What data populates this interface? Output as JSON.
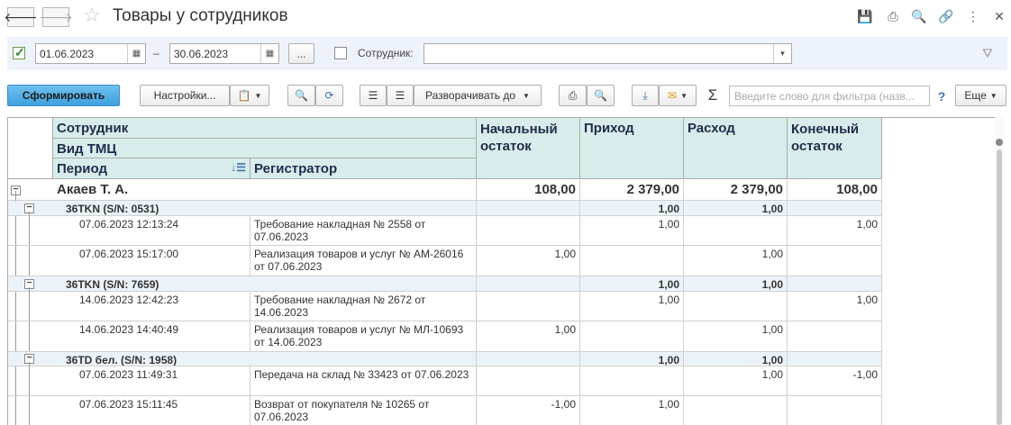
{
  "window": {
    "title": "Товары у сотрудников"
  },
  "filters": {
    "date_from": "01.06.2023",
    "date_to": "30.06.2023",
    "range_dash": "–",
    "more_button": "...",
    "employee_label": "Сотрудник:",
    "employee_value": ""
  },
  "toolbar": {
    "generate": "Сформировать",
    "settings": "Настройки...",
    "expand_to": "Разворачивать до",
    "sum_symbol": "Σ",
    "search_placeholder": "Введите слово для фильтра (назв...",
    "help": "?",
    "more": "Еще"
  },
  "table": {
    "headers": {
      "employee": "Сотрудник",
      "item_type": "Вид ТМЦ",
      "period": "Период",
      "registrar": "Регистратор",
      "opening": "Начальный остаток",
      "incoming": "Приход",
      "outgoing": "Расход",
      "closing": "Конечный остаток"
    },
    "group": {
      "name": "Акаев Т. А.",
      "opening": "108,00",
      "incoming": "2 379,00",
      "outgoing": "2 379,00",
      "closing": "108,00"
    },
    "subgroups": [
      {
        "name": "36TKN (S/N: 0531)",
        "incoming": "1,00",
        "outgoing": "1,00",
        "rows": [
          {
            "period": "07.06.2023 12:13:24",
            "registrar": "Требование накладная № 2558 от 07.06.2023",
            "opening": "",
            "incoming": "1,00",
            "outgoing": "",
            "closing": "1,00"
          },
          {
            "period": "07.06.2023 15:17:00",
            "registrar": "Реализация товаров и услуг № АМ-26016 от 07.06.2023",
            "opening": "1,00",
            "incoming": "",
            "outgoing": "1,00",
            "closing": ""
          }
        ]
      },
      {
        "name": "36TKN (S/N: 7659)",
        "incoming": "1,00",
        "outgoing": "1,00",
        "rows": [
          {
            "period": "14.06.2023 12:42:23",
            "registrar": "Требование накладная № 2672 от 14.06.2023",
            "opening": "",
            "incoming": "1,00",
            "outgoing": "",
            "closing": "1,00"
          },
          {
            "period": "14.06.2023 14:40:49",
            "registrar": "Реализация товаров и услуг № МЛ-10693 от 14.06.2023",
            "opening": "1,00",
            "incoming": "",
            "outgoing": "1,00",
            "closing": ""
          }
        ]
      },
      {
        "name": "36TD бел. (S/N: 1958)",
        "incoming": "1,00",
        "outgoing": "1,00",
        "rows": [
          {
            "period": "07.06.2023 11:49:31",
            "registrar": "Передача на склад № 33423 от 07.06.2023",
            "opening": "",
            "incoming": "",
            "outgoing": "1,00",
            "closing": "-1,00"
          },
          {
            "period": "07.06.2023 15:11:45",
            "registrar": "Возврат от покупателя № 10265 от 07.06.2023",
            "opening": "-1,00",
            "incoming": "1,00",
            "outgoing": "",
            "closing": ""
          }
        ]
      }
    ]
  }
}
